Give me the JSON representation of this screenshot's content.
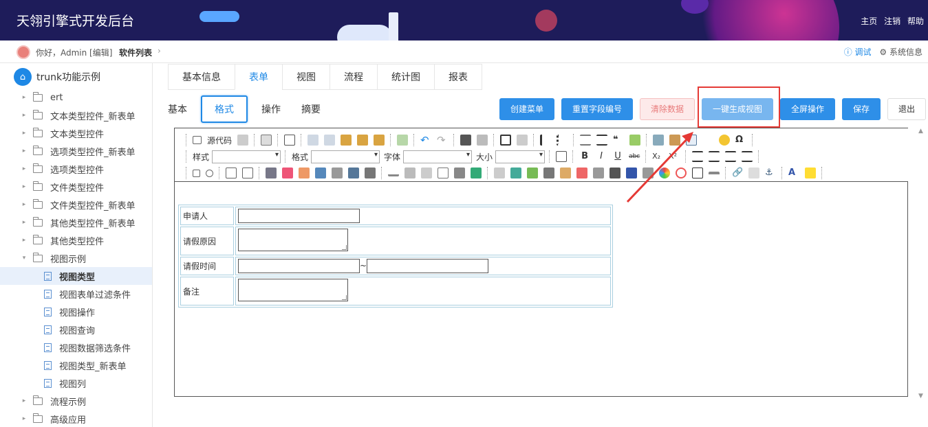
{
  "header": {
    "title": "天翎引擎式开发后台",
    "links": [
      "主页",
      "注销",
      "帮助"
    ]
  },
  "subbar": {
    "greeting": "你好，Admin [编辑]",
    "crumb": "软件列表",
    "debug": "调试",
    "sysinfo": "系统信息"
  },
  "sidebar": {
    "root": "trunk功能示例",
    "items": [
      {
        "label": "ert",
        "type": "folder"
      },
      {
        "label": "文本类型控件_新表单",
        "type": "folder"
      },
      {
        "label": "文本类型控件",
        "type": "folder"
      },
      {
        "label": "选项类型控件_新表单",
        "type": "folder"
      },
      {
        "label": "选项类型控件",
        "type": "folder"
      },
      {
        "label": "文件类型控件",
        "type": "folder"
      },
      {
        "label": "文件类型控件_新表单",
        "type": "folder"
      },
      {
        "label": "其他类型控件_新表单",
        "type": "folder"
      },
      {
        "label": "其他类型控件",
        "type": "folder"
      },
      {
        "label": "视图示例",
        "type": "folder-open"
      },
      {
        "label": "视图类型",
        "type": "doc",
        "selected": true
      },
      {
        "label": "视图表单过滤条件",
        "type": "doc"
      },
      {
        "label": "视图操作",
        "type": "doc"
      },
      {
        "label": "视图查询",
        "type": "doc"
      },
      {
        "label": "视图数据筛选条件",
        "type": "doc"
      },
      {
        "label": "视图类型_新表单",
        "type": "doc"
      },
      {
        "label": "视图列",
        "type": "doc"
      },
      {
        "label": "流程示例",
        "type": "folder"
      },
      {
        "label": "高级应用",
        "type": "folder"
      }
    ]
  },
  "tabs": [
    "基本信息",
    "表单",
    "视图",
    "流程",
    "统计图",
    "报表"
  ],
  "active_tab": "表单",
  "subtabs": [
    "基本",
    "格式",
    "操作",
    "摘要"
  ],
  "active_subtab": "格式",
  "buttons": {
    "create_menu": "创建菜单",
    "reset_field": "重置字段编号",
    "clear_data": "清除数据",
    "gen_view": "一键生成视图",
    "fullscreen": "全屏操作",
    "save": "保存",
    "exit": "退出"
  },
  "toolbar": {
    "source": "源代码",
    "style": "样式",
    "format": "格式",
    "font": "字体",
    "size": "大小"
  },
  "form": {
    "applicant": "申请人",
    "reason": "请假原因",
    "time": "请假时间",
    "tilde": "~",
    "note": "备注"
  }
}
